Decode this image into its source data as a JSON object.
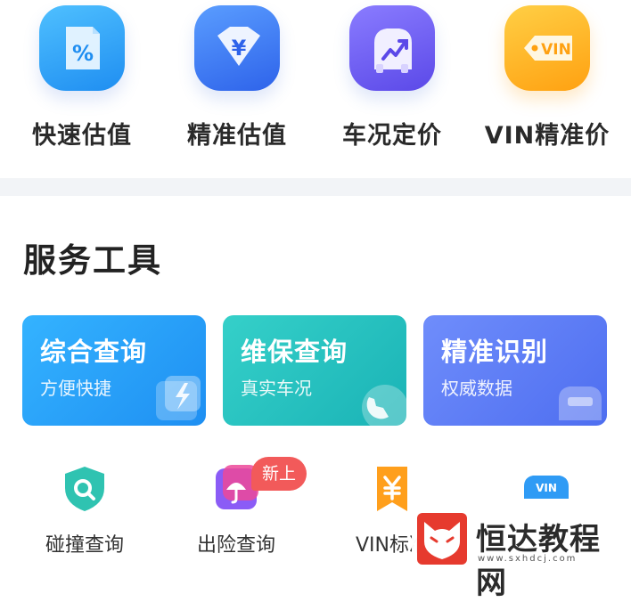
{
  "valuation_items": [
    {
      "label": "快速估值",
      "icon": "percent-tag-icon",
      "glyph": "%",
      "color": "#2fa3f6"
    },
    {
      "label": "精准估值",
      "icon": "yuan-badge-icon",
      "glyph": "¥",
      "color": "#3b7cf5"
    },
    {
      "label": "车况定价",
      "icon": "car-trend-icon",
      "glyph": "↗",
      "color": "#6a5ef0"
    },
    {
      "label": "VIN精准价",
      "icon": "vin-tag-icon",
      "glyph": "VIN",
      "color": "#ffb21f"
    }
  ],
  "services": {
    "title": "服务工具",
    "cards": [
      {
        "title": "综合查询",
        "subtitle": "方便快捷",
        "icon": "lightning-icon",
        "color": "#2a9ff7"
      },
      {
        "title": "维保查询",
        "subtitle": "真实车况",
        "icon": "wrench-icon",
        "color": "#21c2c2"
      },
      {
        "title": "精准识别",
        "subtitle": "权威数据",
        "icon": "car-scan-icon",
        "color": "#5a7cf3"
      }
    ],
    "tools": [
      {
        "label": "碰撞查询",
        "icon": "shield-search-icon"
      },
      {
        "label": "出险查询",
        "icon": "umbrella-icon"
      },
      {
        "label": "VIN标准",
        "icon": "yuan-bookmark-icon"
      },
      {
        "label": "",
        "icon": "vin-car-icon"
      }
    ],
    "new_badge": "新上"
  },
  "watermark": {
    "name": "恒达教程网",
    "url": "www.sxhdcj.com"
  }
}
